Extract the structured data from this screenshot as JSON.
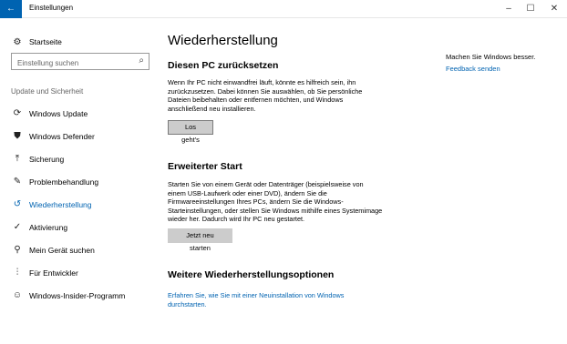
{
  "window": {
    "back_icon": "←",
    "title": "Einstellungen",
    "minimize_icon": "–",
    "maximize_icon": "☐",
    "close_icon": "✕"
  },
  "sidebar": {
    "home": {
      "label": "Startseite",
      "icon": "⚙"
    },
    "search": {
      "placeholder": "Einstellung suchen",
      "value": "",
      "icon": "⌕"
    },
    "section_label": "Update und Sicherheit",
    "items": [
      {
        "label": "Windows Update",
        "icon": "⟳",
        "active": false
      },
      {
        "label": "Windows Defender",
        "icon": "⛊",
        "active": false
      },
      {
        "label": "Sicherung",
        "icon": "⤒",
        "active": false
      },
      {
        "label": "Problembehandlung",
        "icon": "✎",
        "active": false
      },
      {
        "label": "Wiederherstellung",
        "icon": "↺",
        "active": true
      },
      {
        "label": "Aktivierung",
        "icon": "✓",
        "active": false
      },
      {
        "label": "Mein Gerät suchen",
        "icon": "⚲",
        "active": false
      },
      {
        "label": "Für Entwickler",
        "icon": "⫶",
        "active": false
      },
      {
        "label": "Windows-Insider-Programm",
        "icon": "☺",
        "active": false
      }
    ]
  },
  "main": {
    "title": "Wiederherstellung",
    "reset": {
      "heading": "Diesen PC zurücksetzen",
      "text": "Wenn Ihr PC nicht einwandfrei läuft, könnte es hilfreich sein, ihn zurückzusetzen. Dabei können Sie auswählen, ob Sie persönliche Dateien beibehalten oder entfernen möchten, und Windows anschließend neu installieren.",
      "button": "Los geht's"
    },
    "advanced": {
      "heading": "Erweiterter Start",
      "text": "Starten Sie von einem Gerät oder Datenträger (beispielsweise von einem USB-Laufwerk oder einer DVD), ändern Sie die Firmwareeinstellungen Ihres PCs, ändern Sie die Windows-Starteinstellungen, oder stellen Sie Windows mithilfe eines Systemimage wieder her. Dadurch wird Ihr PC neu gestartet.",
      "button": "Jetzt neu starten"
    },
    "more": {
      "heading": "Weitere Wiederherstellungsoptionen",
      "link": "Erfahren Sie, wie Sie mit einer Neuinstallation von Windows durchstarten."
    }
  },
  "aside": {
    "text": "Machen Sie Windows besser.",
    "link": "Feedback senden"
  },
  "colors": {
    "accent": "#0063b1",
    "button_bg": "#cccccc"
  }
}
